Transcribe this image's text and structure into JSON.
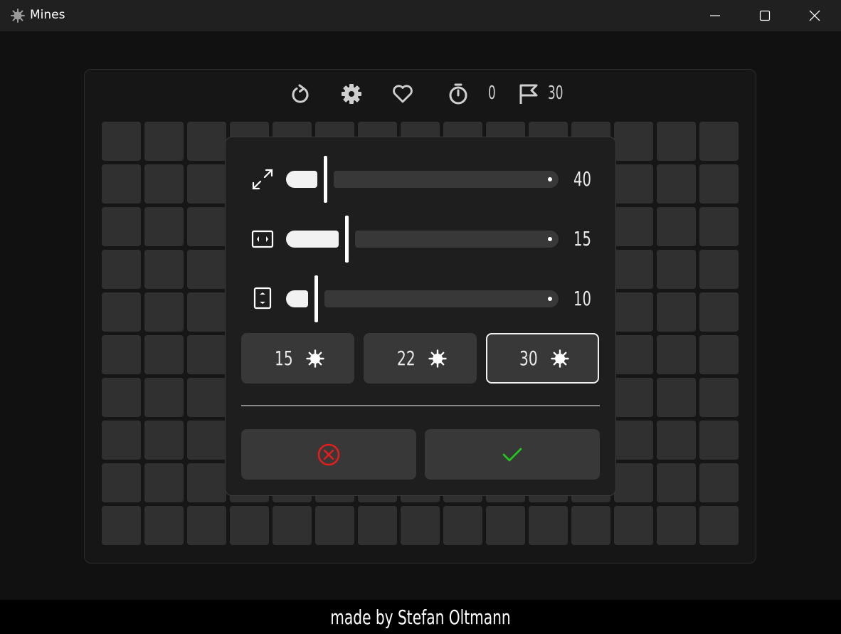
{
  "window": {
    "title": "Mines"
  },
  "toolbar": {
    "timer_value": "0",
    "flags_value": "30"
  },
  "settings": {
    "sliders": [
      {
        "name": "size",
        "icon": "expand-icon",
        "value": "40",
        "fraction": 0.08
      },
      {
        "name": "width",
        "icon": "width-icon",
        "value": "15",
        "fraction": 0.2
      },
      {
        "name": "height",
        "icon": "height-icon",
        "value": "10",
        "fraction": 0.05
      }
    ],
    "presets": [
      {
        "label": "15",
        "selected": false
      },
      {
        "label": "22",
        "selected": false
      },
      {
        "label": "30",
        "selected": true
      }
    ]
  },
  "colors": {
    "cancel": "#e11d1d",
    "confirm": "#22c41e",
    "cell": "#303030"
  },
  "footer": {
    "credit": "made by Stefan Oltmann"
  }
}
